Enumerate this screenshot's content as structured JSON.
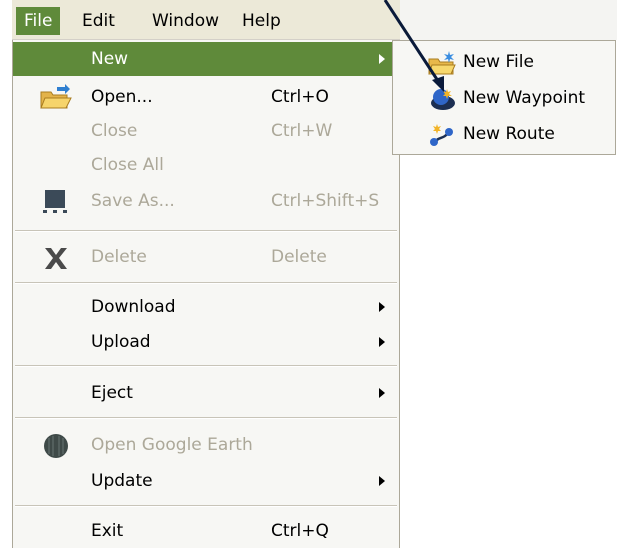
{
  "menubar": {
    "items": [
      {
        "label": "File",
        "active": true
      },
      {
        "label": "Edit"
      },
      {
        "label": "Window"
      },
      {
        "label": "Help"
      }
    ]
  },
  "file_menu": {
    "new": {
      "label": "New"
    },
    "open": {
      "label": "Open...",
      "shortcut": "Ctrl+O",
      "icon": "folder-open-icon"
    },
    "close": {
      "label": "Close",
      "shortcut": "Ctrl+W",
      "disabled": true
    },
    "close_all": {
      "label": "Close All",
      "disabled": true
    },
    "save_as": {
      "label": "Save As...",
      "shortcut": "Ctrl+Shift+S",
      "disabled": true,
      "icon": "save-icon"
    },
    "delete": {
      "label": "Delete",
      "shortcut": "Delete",
      "disabled": true,
      "icon": "delete-x-icon"
    },
    "download": {
      "label": "Download"
    },
    "upload": {
      "label": "Upload"
    },
    "eject": {
      "label": "Eject"
    },
    "open_google_earth": {
      "label": "Open Google Earth",
      "disabled": true,
      "icon": "google-earth-icon"
    },
    "update": {
      "label": "Update"
    },
    "exit": {
      "label": "Exit",
      "shortcut": "Ctrl+Q"
    }
  },
  "new_submenu": {
    "new_file": {
      "label": "New File",
      "icon": "new-folder-icon"
    },
    "new_waypoint": {
      "label": "New Waypoint",
      "icon": "waypoint-icon"
    },
    "new_route": {
      "label": "New Route",
      "icon": "route-icon"
    }
  },
  "colors": {
    "highlight": "#5f8a3a",
    "menu_bg": "#f7f7f4",
    "disabled_text": "#aca899",
    "arrow": "#0a1a3a"
  }
}
